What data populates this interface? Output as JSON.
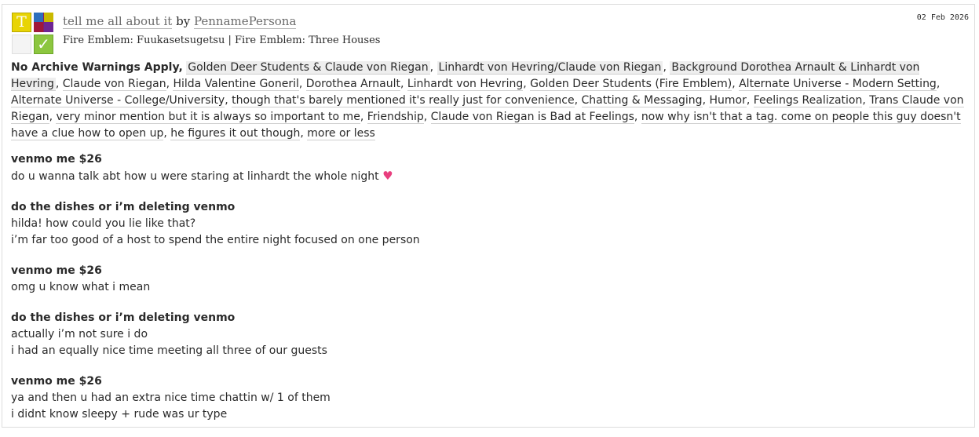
{
  "work": {
    "title": "tell me all about it",
    "by": "by",
    "author": "PennamePersona",
    "date": "02 Feb 2026",
    "fandoms": [
      "Fire Emblem: Fuukasetsugetsu",
      "Fire Emblem: Three Houses"
    ],
    "fandom_separator": "|",
    "icons": {
      "rating": "T",
      "rating_icon": "teen-rating-icon",
      "category_icon": "multi-category-icon",
      "warning_icon": "no-warnings-icon",
      "complete_icon": "complete-check-icon",
      "complete_glyph": "✓"
    }
  },
  "tags": {
    "warning": "No Archive Warnings Apply,",
    "relationships": [
      "Golden Deer Students & Claude von Riegan",
      "Linhardt von Hevring/Claude von Riegan",
      "Background Dorothea Arnault & Linhardt von Hevring"
    ],
    "freeforms": [
      "Claude von Riegan",
      "Hilda Valentine Goneril",
      "Dorothea Arnault",
      "Linhardt von Hevring",
      "Golden Deer Students (Fire Emblem)",
      "Alternate Universe - Modern Setting",
      "Alternate Universe - College/University",
      "though that's barely mentioned it's really just for convenience",
      "Chatting & Messaging",
      "Humor",
      "Feelings Realization",
      "Trans Claude von Riegan",
      "very minor mention but it is always so important to me",
      "Friendship",
      "Claude von Riegan is Bad at Feelings",
      "now why isn't that a tag. come on people this guy doesn't have a clue how to open up",
      "he figures it out though",
      "more or less"
    ]
  },
  "messages": [
    {
      "sender": "venmo me $26",
      "lines": [
        "do u wanna talk abt how u were staring at linhardt the whole night"
      ],
      "emoji": "♥"
    },
    {
      "sender": "do the dishes or i’m deleting venmo",
      "lines": [
        "hilda! how could you lie like that?",
        "i’m far too good of a host to spend the entire night focused on one person"
      ]
    },
    {
      "sender": "venmo me $26",
      "lines": [
        "omg u know what i mean"
      ]
    },
    {
      "sender": "do the dishes or i’m deleting venmo",
      "lines": [
        "actually i’m not sure i do",
        "i had an equally nice time meeting all three of our guests"
      ]
    },
    {
      "sender": "venmo me $26",
      "lines": [
        "ya and then u had an extra nice time chattin w/ 1 of them",
        "i didnt know sleepy + rude was ur type"
      ]
    }
  ]
}
